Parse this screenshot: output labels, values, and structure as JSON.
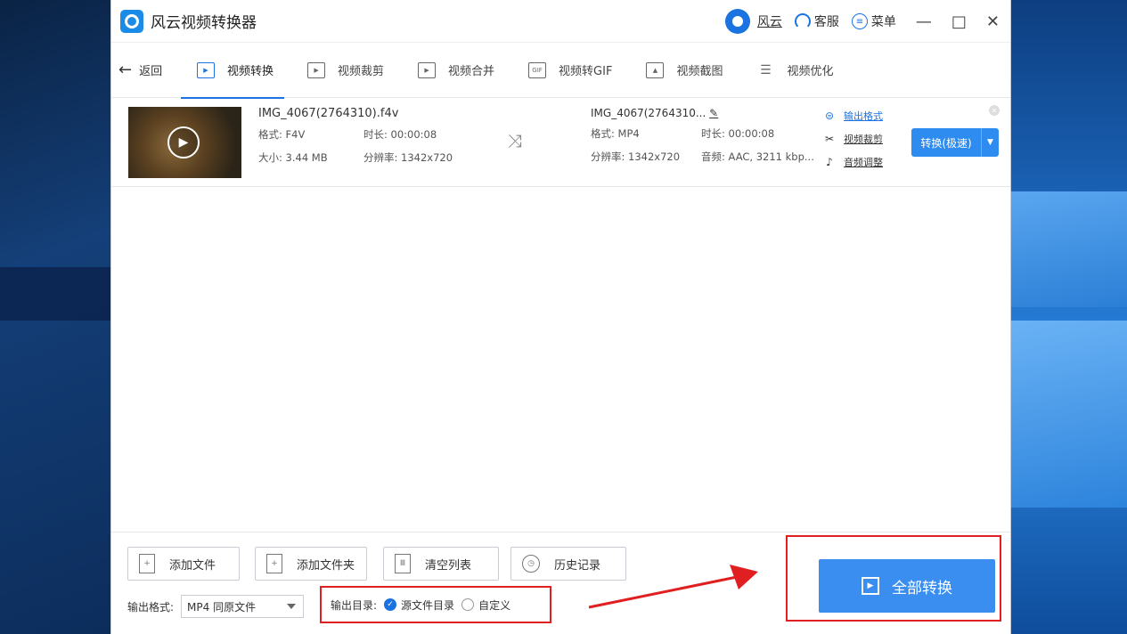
{
  "app": {
    "title": "风云视频转换器"
  },
  "titlebar": {
    "brand_label": "风云",
    "support_label": "客服",
    "menu_label": "菜单",
    "minimize": "—",
    "maximize": "□",
    "close": "✕"
  },
  "tabs": {
    "back_label": "返回",
    "items": [
      {
        "label": "视频转换",
        "icon": "video-convert-icon",
        "active": true
      },
      {
        "label": "视频裁剪",
        "icon": "video-crop-icon",
        "active": false
      },
      {
        "label": "视频合并",
        "icon": "video-merge-icon",
        "active": false
      },
      {
        "label": "视频转GIF",
        "icon": "gif-icon",
        "active": false
      },
      {
        "label": "视频截图",
        "icon": "screenshot-icon",
        "active": false
      },
      {
        "label": "视频优化",
        "icon": "optimize-icon",
        "active": false
      }
    ]
  },
  "file": {
    "source": {
      "name": "IMG_4067(2764310).f4v",
      "format": "格式: F4V",
      "duration": "时长: 00:00:08",
      "size": "大小: 3.44 MB",
      "resolution": "分辨率: 1342x720"
    },
    "output": {
      "name": "IMG_4067(2764310...",
      "format": "格式: MP4",
      "duration": "时长: 00:00:08",
      "resolution": "分辨率: 1342x720",
      "audio": "音频: AAC, 3211 kbp..."
    },
    "actions": {
      "format_label": "输出格式",
      "crop_label": "视频裁剪",
      "audio_label": "音频调整"
    },
    "convert_label": "转换(极速)"
  },
  "bottom": {
    "add_file": "添加文件",
    "add_folder": "添加文件夹",
    "clear_list": "清空列表",
    "history": "历史记录",
    "output_format_label": "输出格式:",
    "output_format_value": "MP4 同原文件",
    "output_dir_label": "输出目录:",
    "dir_source": "源文件目录",
    "dir_custom": "自定义",
    "convert_all": "全部转换"
  },
  "colors": {
    "accent": "#1a73e0",
    "button_blue": "#3a8ef0",
    "highlight_red": "#e02020"
  }
}
